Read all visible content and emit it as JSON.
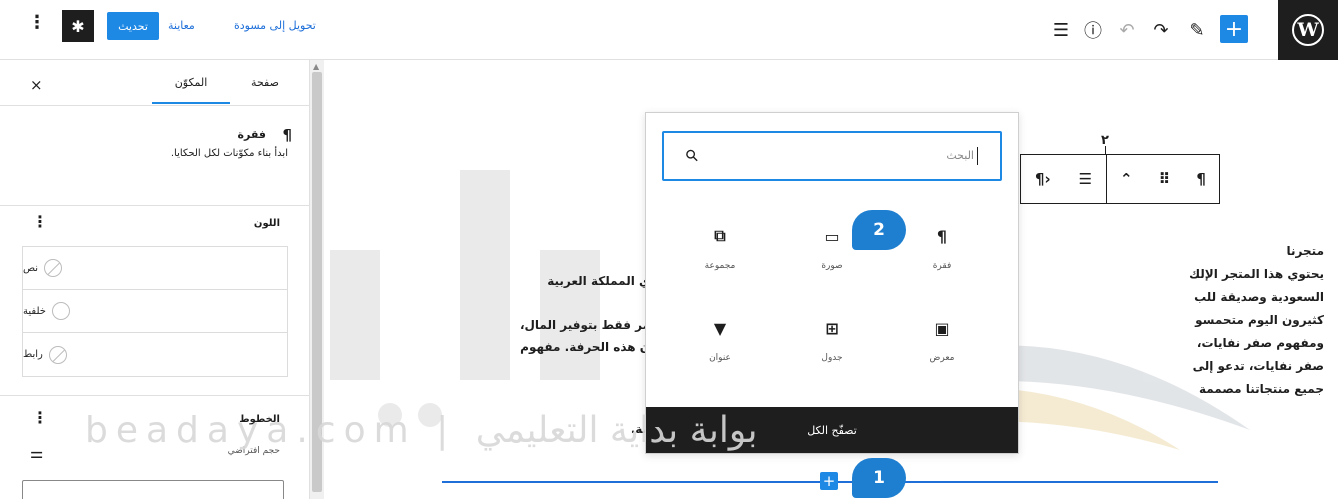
{
  "toolbar": {
    "add_label": "+",
    "update_label": "تحديث",
    "preview_label": "معاينة",
    "switch_draft_label": "تحويل إلى مسودة",
    "settings_glyph": "✱",
    "kebab_glyph": "⋮",
    "outline_glyph": "☰",
    "info_glyph": "ⓘ",
    "undo_glyph": "↶",
    "redo_glyph": "↷",
    "edit_glyph": "✎",
    "logo_text": "W"
  },
  "sidebar": {
    "tab_page": "صفحة",
    "tab_block": "المكوّن",
    "close_glyph": "×",
    "block_card": {
      "icon": "¶",
      "title": "فقرة",
      "description": "ابدأ بناء مكوّنات لكل الحكايا."
    },
    "color": {
      "title": "اللون",
      "more_glyph": "⋮",
      "items": [
        {
          "label": "نص",
          "swatch": "none"
        },
        {
          "label": "خلفية",
          "swatch": "empty"
        },
        {
          "label": "رابط",
          "swatch": "none"
        }
      ]
    },
    "typography": {
      "title": "الخطوط",
      "more_glyph": "⋮",
      "subtitle": "حجم افتراضي",
      "sliders_glyph": "⚌"
    }
  },
  "block_toolbar": {
    "pilcrow": "¶",
    "drag": "⠿",
    "move": "⌃",
    "align": "☰",
    "text_dir": "¶›"
  },
  "content": {
    "heading": "متجرنا",
    "right_lines": [
      "يحتوي هذا المتجر الإلك",
      "السعودية وصديقة للب",
      "كثيرون اليوم متحمسو",
      "ومفهوم صفر نفايات،",
      "صفر نفايات، تدعو إلى",
      "جميع منتجاتنا مصممة"
    ],
    "left_lines": [
      "ي المملكة العربية",
      "مر فقط بتوفير المال،",
      "ن هذه الحرفة. مفهوم"
    ],
    "left_last": "مة."
  },
  "inserter": {
    "search_placeholder": "البحث",
    "blocks": [
      {
        "name": "paragraph",
        "label": "فقرة",
        "icon": "¶"
      },
      {
        "name": "image",
        "label": "صورة",
        "icon": "▭"
      },
      {
        "name": "group",
        "label": "مجموعة",
        "icon": "⧉"
      },
      {
        "name": "gallery",
        "label": "معرض",
        "icon": "▣"
      },
      {
        "name": "table",
        "label": "جدول",
        "icon": "⊞"
      },
      {
        "name": "heading",
        "label": "عنوان",
        "icon": "▼"
      }
    ],
    "browse_all": "تصفّح الكل"
  },
  "insert_plus": "+",
  "callouts": {
    "one": "1",
    "two": "2"
  },
  "watermark": "beadaya.com | بوابة بداية التعليمي",
  "colors": {
    "accent": "#1e88e5",
    "dark": "#1e1e1e",
    "callout": "#1e7fd0"
  }
}
